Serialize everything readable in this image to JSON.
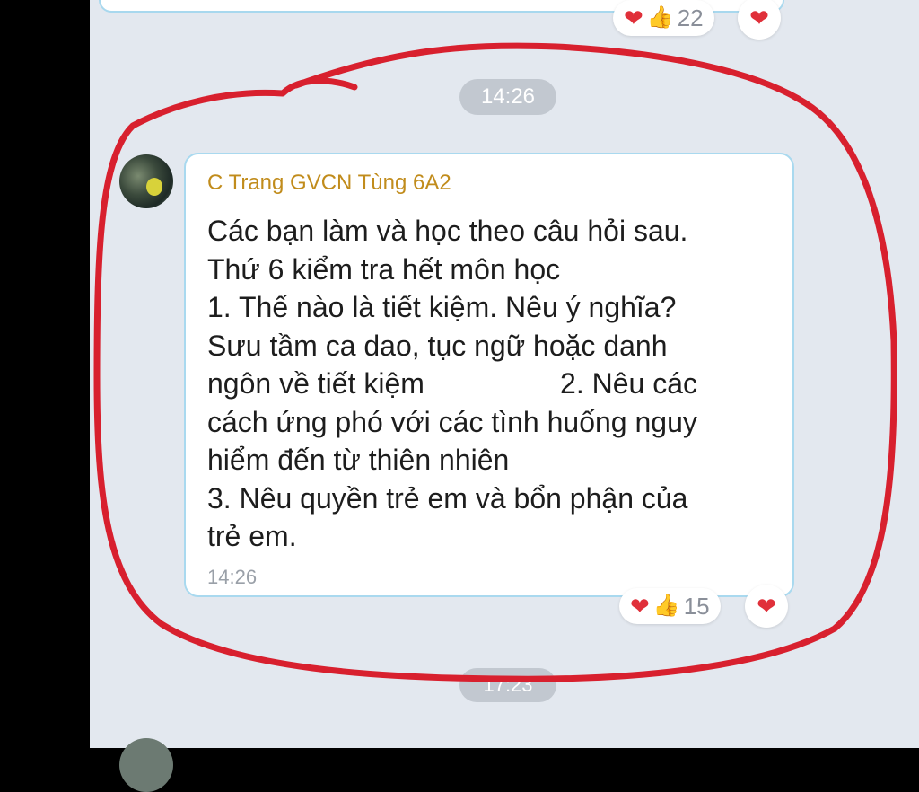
{
  "previous_message": {
    "reactions": {
      "count": "22",
      "icons": [
        "heart-icon",
        "thumbs-up-icon"
      ]
    }
  },
  "time_divider_1": "14:26",
  "message": {
    "sender": "C Trang GVCN Tùng 6A2",
    "text": "Các bạn làm và học theo câu hỏi sau.\nThứ 6 kiểm tra hết môn học\n1. Thế nào là tiết kiệm. Nêu ý nghĩa?\nSưu tầm ca dao, tục ngữ hoặc danh\nngôn về tiết kiệm                 2. Nêu các\ncách ứng phó với các tình huống nguy\nhiểm đến từ thiên nhiên\n3. Nêu quyền trẻ em và bổn phận của\ntrẻ em.",
    "time": "14:26",
    "reactions": {
      "count": "15",
      "icons": [
        "heart-icon",
        "thumbs-up-icon"
      ]
    }
  },
  "time_divider_2": "17:23",
  "colors": {
    "chat_background": "#e3e8ef",
    "bubble_border": "#a9d9ef",
    "sender_name": "#c18c1c",
    "annotation_circle": "#d8202e"
  }
}
